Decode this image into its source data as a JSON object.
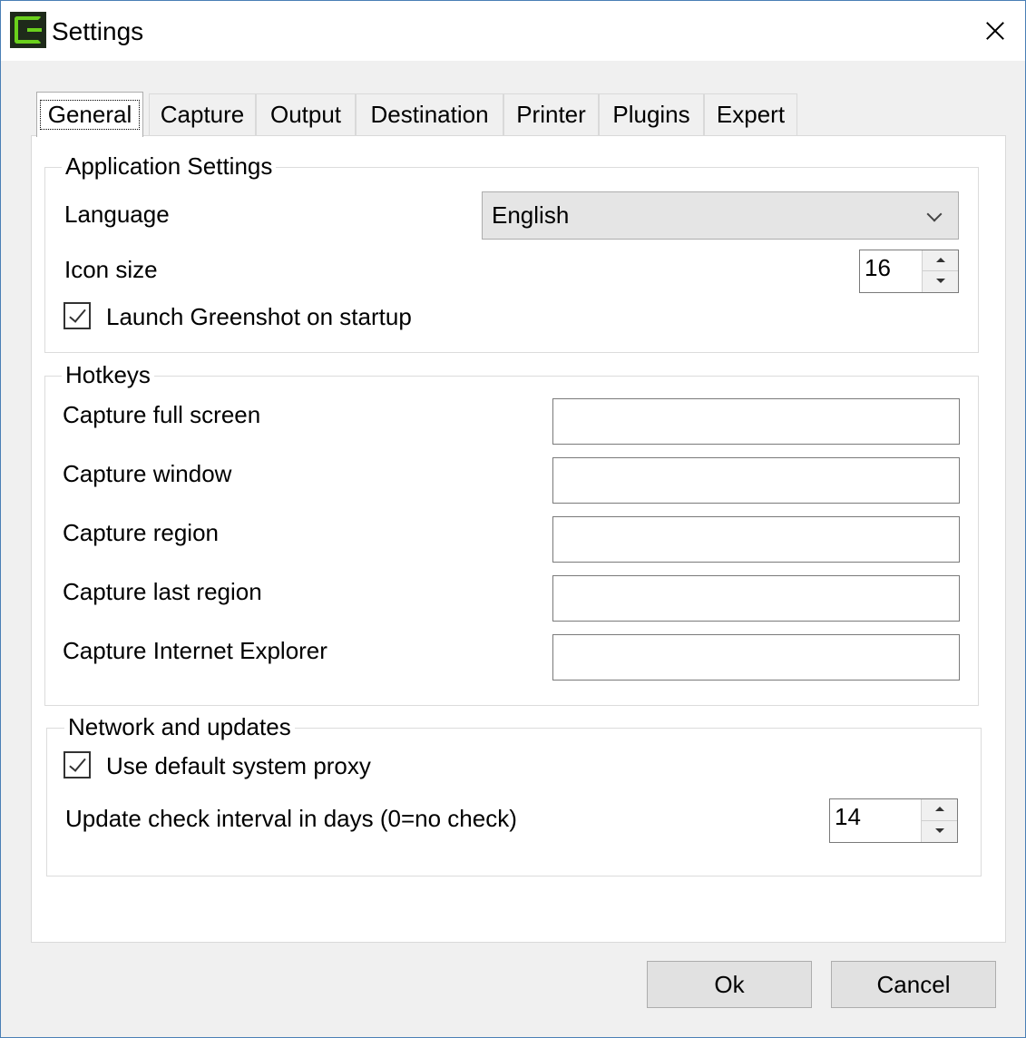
{
  "window": {
    "title": "Settings",
    "close_icon": "close-icon"
  },
  "tabs": [
    {
      "label": "General",
      "active": true
    },
    {
      "label": "Capture"
    },
    {
      "label": "Output"
    },
    {
      "label": "Destination"
    },
    {
      "label": "Printer"
    },
    {
      "label": "Plugins"
    },
    {
      "label": "Expert"
    }
  ],
  "application_settings": {
    "title": "Application Settings",
    "language_label": "Language",
    "language_value": "English",
    "icon_size_label": "Icon size",
    "icon_size_value": "16",
    "launch_label": "Launch Greenshot on startup",
    "launch_checked": true
  },
  "hotkeys": {
    "title": "Hotkeys",
    "items": [
      {
        "label": "Capture full screen",
        "value": ""
      },
      {
        "label": "Capture window",
        "value": ""
      },
      {
        "label": "Capture region",
        "value": ""
      },
      {
        "label": "Capture last region",
        "value": ""
      },
      {
        "label": "Capture Internet Explorer",
        "value": ""
      }
    ]
  },
  "network": {
    "title": "Network and updates",
    "proxy_label": "Use default system proxy",
    "proxy_checked": true,
    "update_label": "Update check interval in days (0=no check)",
    "update_value": "14"
  },
  "buttons": {
    "ok": "Ok",
    "cancel": "Cancel"
  }
}
